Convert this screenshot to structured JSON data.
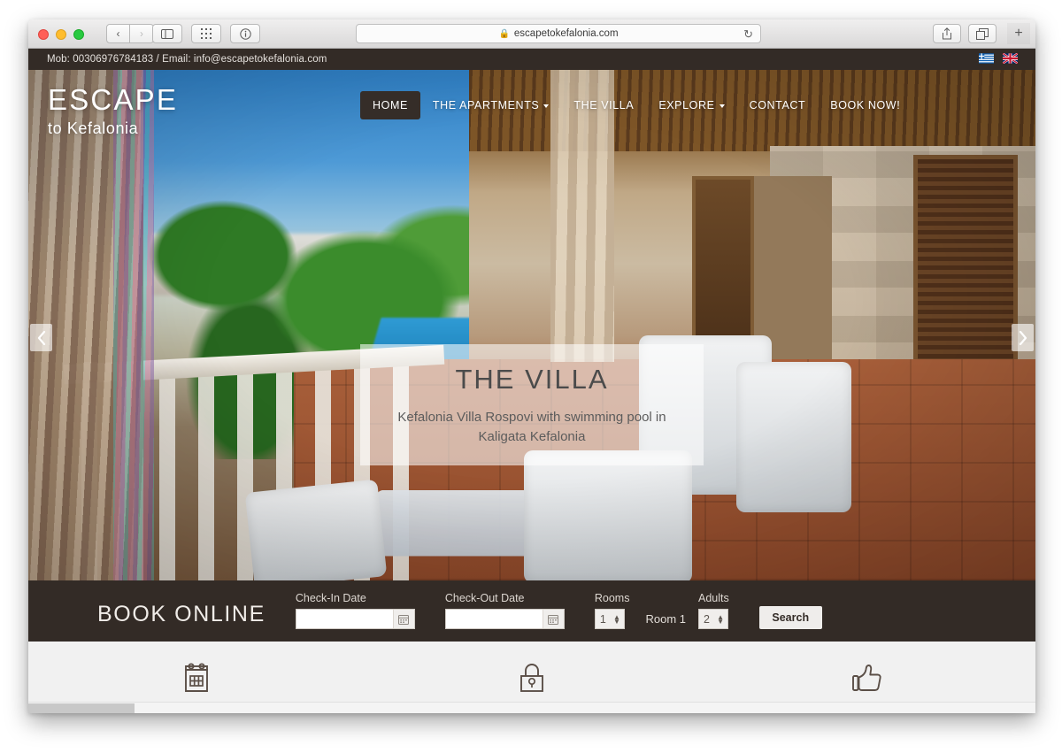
{
  "browser": {
    "url": "escapetokefalonia.com",
    "lock_icon": "lock-icon",
    "back_label": "‹",
    "forward_label": "›",
    "sidebar_icon": "sidebar-icon",
    "tabs_overview_icon": "grid-icon",
    "reader_icon": "info-icon",
    "share_icon": "share-icon",
    "duplicate_tabs_icon": "tabs-icon",
    "new_tab_label": "+",
    "reload_label": "↻"
  },
  "topbar": {
    "contact": "Mob: 00306976784183 / Email: info@escapetokefalonia.com",
    "languages": [
      {
        "name": "greek-flag",
        "label": "Greek"
      },
      {
        "name": "uk-flag",
        "label": "English"
      }
    ]
  },
  "logo": {
    "main": "ESCAPE",
    "sub": "to Kefalonia"
  },
  "nav": {
    "items": [
      {
        "label": "HOME",
        "active": true,
        "has_dropdown": false
      },
      {
        "label": "THE APARTMENTS",
        "active": false,
        "has_dropdown": true
      },
      {
        "label": "THE VILLA",
        "active": false,
        "has_dropdown": false
      },
      {
        "label": "EXPLORE",
        "active": false,
        "has_dropdown": true
      },
      {
        "label": "CONTACT",
        "active": false,
        "has_dropdown": false
      },
      {
        "label": "BOOK NOW!",
        "active": false,
        "has_dropdown": false
      }
    ]
  },
  "hero": {
    "title": "THE VILLA",
    "subtitle": "Kefalonia Villa Rospovi with swimming pool in Kaligata Kefalonia",
    "prev_label": "previous-slide",
    "next_label": "next-slide"
  },
  "booking": {
    "title": "BOOK ONLINE",
    "checkin_label": "Check-In Date",
    "checkin_value": "",
    "checkin_placeholder": "",
    "checkout_label": "Check-Out Date",
    "checkout_value": "",
    "checkout_placeholder": "",
    "rooms_label": "Rooms",
    "rooms_value": "1",
    "room_label": "Room 1",
    "adults_label": "Adults",
    "adults_value": "2",
    "search_label": "Search"
  },
  "features": [
    {
      "icon": "calendar-icon"
    },
    {
      "icon": "lock-icon"
    },
    {
      "icon": "thumbs-up-icon"
    }
  ],
  "colors": {
    "dark_brown": "#332b26",
    "page_bg": "#f1f1f1",
    "caption_bg": "rgba(255,255,255,0.58)"
  }
}
